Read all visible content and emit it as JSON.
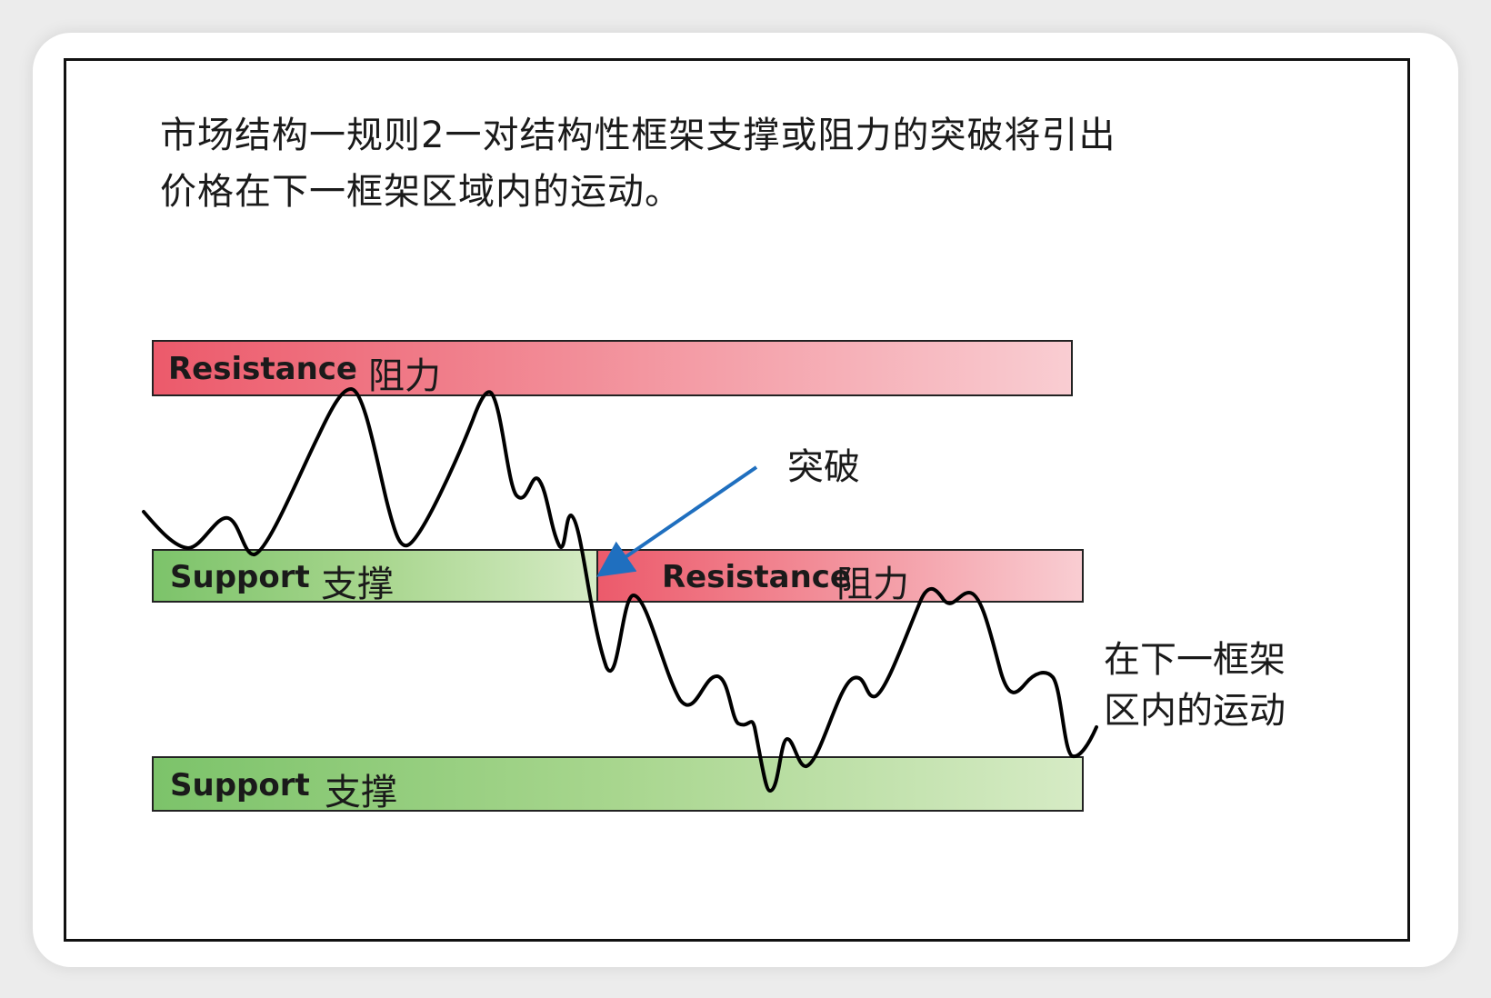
{
  "title": {
    "line1": "市场结构一规则2一对结构性框架支撑或阻力的突破将引出",
    "line2": "价格在下一框架区域内的运动。"
  },
  "bands": {
    "top_resistance": {
      "label_en": "Resistance",
      "label_cn": "阻力"
    },
    "mid_support": {
      "label_en": "Support",
      "label_cn": "支撑"
    },
    "mid_resistance": {
      "label_en": "Resistance",
      "label_cn": "阻力"
    },
    "bottom_support": {
      "label_en": "Support",
      "label_cn": "支撑"
    }
  },
  "annotations": {
    "breakout": "突破",
    "next_zone_line1": "在下一框架",
    "next_zone_line2": "区内的运动"
  },
  "colors": {
    "resistance": "#ec5a6b",
    "support": "#7cc36a",
    "arrow": "#1f6fbf",
    "price_line": "#000000"
  }
}
